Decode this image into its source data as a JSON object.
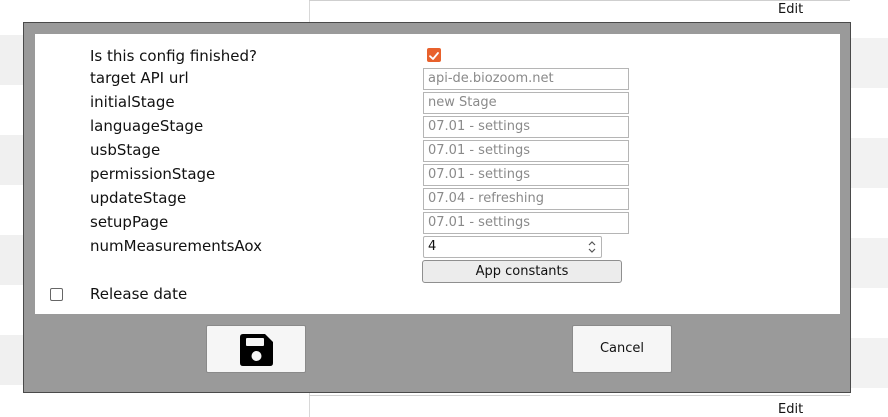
{
  "background": {
    "edit_top": "Edit",
    "edit_bottom": "Edit"
  },
  "dialog": {
    "finished_label": "Is this config finished?",
    "finished_checked": true,
    "fields": [
      {
        "label": "target API url",
        "value": "api-de.biozoom.net"
      },
      {
        "label": "initialStage",
        "value": "new Stage"
      },
      {
        "label": "languageStage",
        "value": "07.01 - settings"
      },
      {
        "label": "usbStage",
        "value": "07.01 - settings"
      },
      {
        "label": "permissionStage",
        "value": "07.01 - settings"
      },
      {
        "label": "updateStage",
        "value": "07.04 - refreshing"
      },
      {
        "label": "setupPage",
        "value": "07.01 - settings"
      }
    ],
    "num_measurements": {
      "label": "numMeasurementsAox",
      "value": "4"
    },
    "app_constants_label": "App constants",
    "release_date": {
      "label": "Release date",
      "checked": false
    },
    "save_icon": "floppy-disk-icon",
    "cancel_label": "Cancel"
  },
  "colors": {
    "accent": "#e8612c",
    "overlay": "#9a9a9a"
  }
}
